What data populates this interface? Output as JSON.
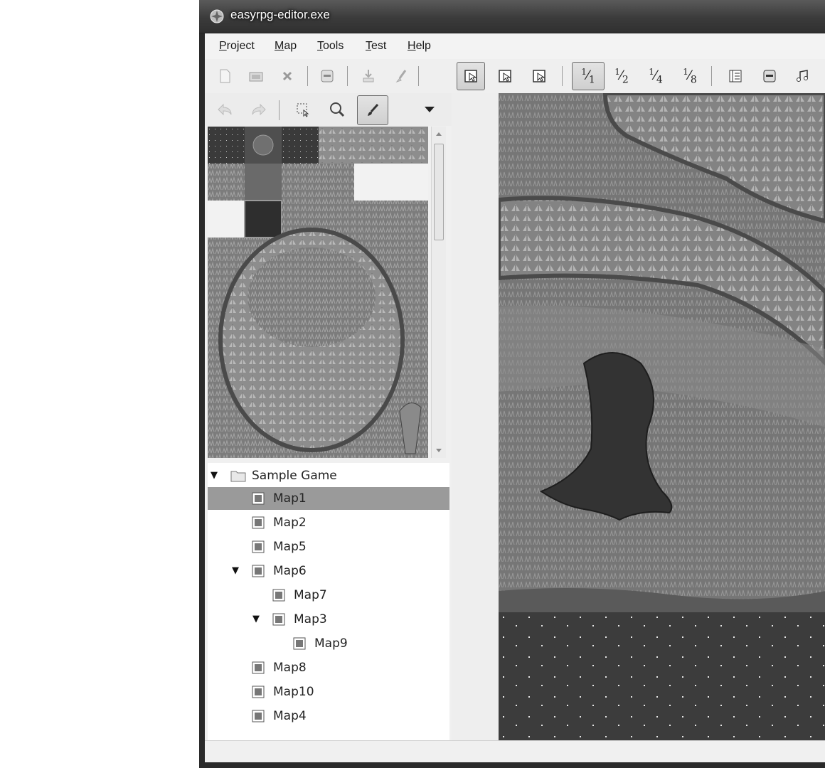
{
  "window": {
    "title": "easyrpg-editor.exe"
  },
  "menu": {
    "items": [
      {
        "label": "Project",
        "accel": "P",
        "rest": "roject"
      },
      {
        "label": "Map",
        "accel": "M",
        "rest": "ap"
      },
      {
        "label": "Tools",
        "accel": "T",
        "rest": "ools"
      },
      {
        "label": "Test",
        "accel": "T",
        "rest": "est"
      },
      {
        "label": "Help",
        "accel": "H",
        "rest": "elp"
      }
    ]
  },
  "toolbar": {
    "zoom": [
      {
        "num": "1",
        "den": "1",
        "pressed": true
      },
      {
        "num": "1",
        "den": "2",
        "pressed": false
      },
      {
        "num": "1",
        "den": "4",
        "pressed": false
      },
      {
        "num": "1",
        "den": "8",
        "pressed": false
      }
    ],
    "icons": [
      "new-project-icon",
      "open-project-icon",
      "close-project-icon",
      "save-icon",
      "import-icon",
      "brush-clean-icon",
      "lower-layer-icon",
      "upper-layer-icon",
      "event-layer-icon",
      "database-icon",
      "resource-icon",
      "music-icon"
    ]
  },
  "map_tree": {
    "root": "Sample Game",
    "items": [
      {
        "label": "Map1",
        "depth": 1,
        "selected": true,
        "expanded": null
      },
      {
        "label": "Map2",
        "depth": 1,
        "selected": false,
        "expanded": null
      },
      {
        "label": "Map5",
        "depth": 1,
        "selected": false,
        "expanded": null
      },
      {
        "label": "Map6",
        "depth": 1,
        "selected": false,
        "expanded": true
      },
      {
        "label": "Map7",
        "depth": 2,
        "selected": false,
        "expanded": null
      },
      {
        "label": "Map3",
        "depth": 2,
        "selected": false,
        "expanded": true
      },
      {
        "label": "Map9",
        "depth": 3,
        "selected": false,
        "expanded": null
      },
      {
        "label": "Map8",
        "depth": 1,
        "selected": false,
        "expanded": null
      },
      {
        "label": "Map10",
        "depth": 1,
        "selected": false,
        "expanded": null
      },
      {
        "label": "Map4",
        "depth": 1,
        "selected": false,
        "expanded": null
      }
    ]
  },
  "colors": {
    "selection": "#9a9a9a",
    "map_ground": "#6e6e6e",
    "water": "#3c3c3c"
  }
}
